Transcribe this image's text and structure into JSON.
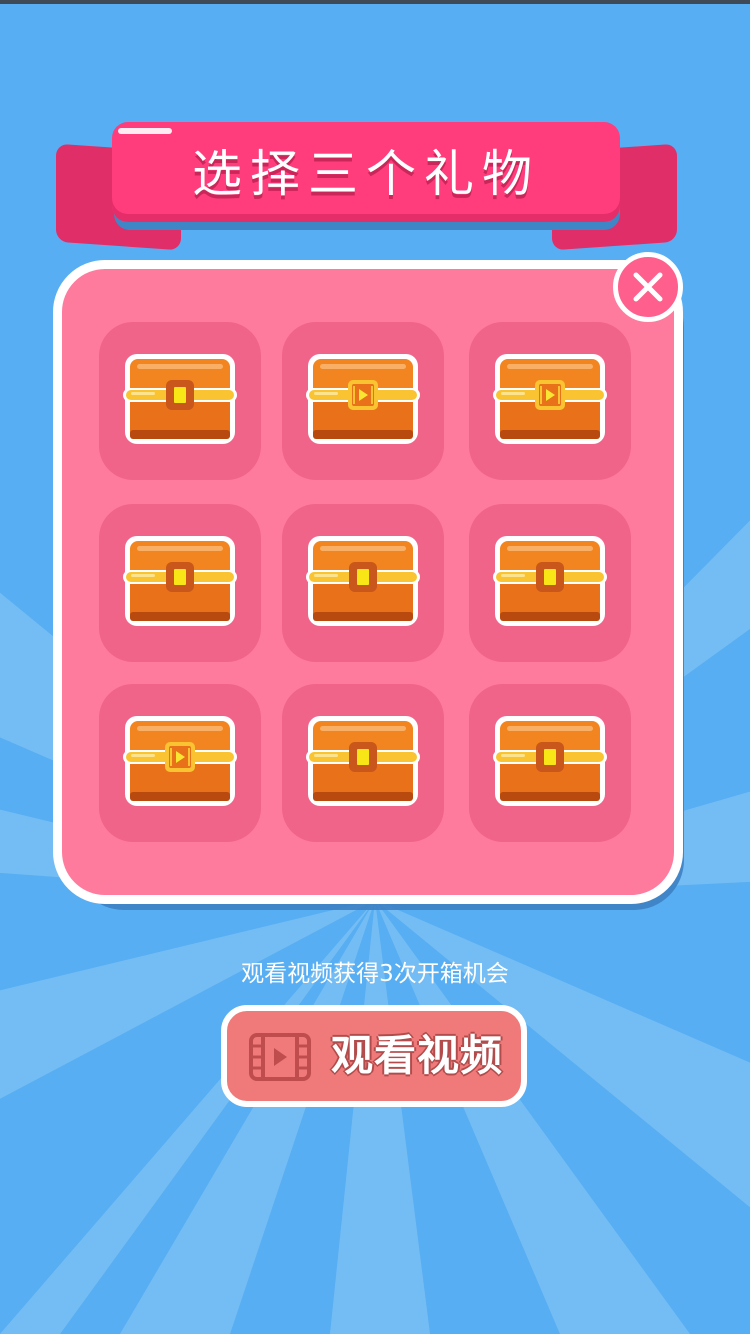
{
  "title": "选择三个礼物",
  "hint": "观看视频获得3次开箱机会",
  "watch_button_label": "观看视频",
  "chests": [
    {
      "lock": "keyhole"
    },
    {
      "lock": "video"
    },
    {
      "lock": "video"
    },
    {
      "lock": "keyhole"
    },
    {
      "lock": "keyhole"
    },
    {
      "lock": "keyhole"
    },
    {
      "lock": "video"
    },
    {
      "lock": "keyhole"
    },
    {
      "lock": "keyhole"
    }
  ],
  "colors": {
    "background": "#58aef2",
    "panel": "#ff7b9e",
    "ribbon": "#ff3d7c",
    "slot": "#f0648a",
    "chest": "#f2851f",
    "button": "#f07a7a"
  }
}
